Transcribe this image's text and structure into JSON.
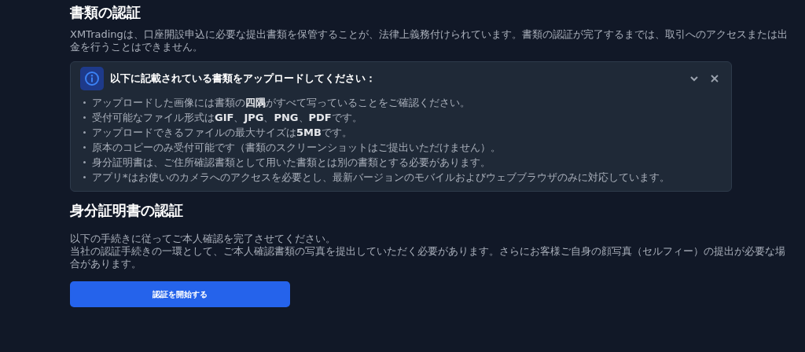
{
  "section1": {
    "title": "書類の認証",
    "description": "XMTradingは、口座開設申込に必要な提出書類を保管することが、法律上義務付けられています。書類の認証が完了するまでは、取引へのアクセスまたは出金を行うことはできません。"
  },
  "notice": {
    "title": "以下に記載されている書類をアップロードしてください：",
    "expanded": true,
    "items": [
      "アップロードした画像には書類の**四隅**がすべて写っていることをご確認ください。",
      "受付可能なファイル形式は**GIF**、**JPG**、**PNG**、**PDF**です。",
      "アップロードできるファイルの最大サイズは**5MB**です。",
      "原本のコピーのみ受付可能です（書類のスクリーンショットはご提出いただけません）。",
      "身分証明書は、ご住所確認書類として用いた書類とは別の書類とする必要があります。",
      "アプリ*はお使いのカメラへのアクセスを必要とし、最新バージョンのモバイルおよびウェブブラウザのみに対応しています。"
    ]
  },
  "section2": {
    "title": "身分証明書の認証",
    "lines": [
      "以下の手続きに従ってご本人確認を完了させてください。",
      "当社の認証手続きの一環として、ご本人確認書類の写真を提出していただく必要があります。さらにお客様ご自身の顔写真（セルフィー）の提出が必要な場合があります。"
    ]
  },
  "button": {
    "label": "認証を開始する"
  }
}
